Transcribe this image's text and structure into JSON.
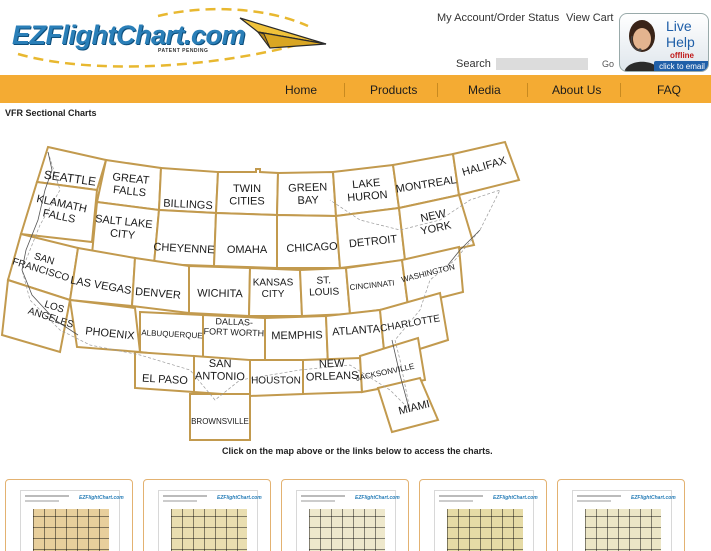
{
  "header": {
    "logo_text": "EZFlightChart.com",
    "logo_tagline": "PATENT PENDING",
    "account_link": "My Account/Order Status",
    "cart_link": "View Cart",
    "search_label": "Search",
    "search_value": "",
    "search_go": "Go",
    "live_help": {
      "line1": "Live",
      "line2": "Help",
      "status": "offline",
      "cta": "click to email"
    }
  },
  "nav": {
    "items": [
      "Home",
      "Products",
      "Media",
      "About Us",
      "FAQ"
    ]
  },
  "page_title": "VFR Sectional Charts",
  "map": {
    "regions": [
      [
        "SEATTLE"
      ],
      [
        "GREAT",
        "FALLS"
      ],
      [
        "BILLINGS"
      ],
      [
        "TWIN",
        "CITIES"
      ],
      [
        "GREEN",
        "BAY"
      ],
      [
        "LAKE",
        "HURON"
      ],
      [
        "MONTREAL"
      ],
      [
        "HALIFAX"
      ],
      [
        "KLAMATH",
        "FALLS"
      ],
      [
        "SALT LAKE",
        "CITY"
      ],
      [
        "CHEYENNE"
      ],
      [
        "OMAHA"
      ],
      [
        "CHICAGO"
      ],
      [
        "DETROIT"
      ],
      [
        "NEW",
        "YORK"
      ],
      [
        "SAN",
        "FRANCISCO"
      ],
      [
        "LAS VEGAS"
      ],
      [
        "DENVER"
      ],
      [
        "WICHITA"
      ],
      [
        "KANSAS",
        "CITY"
      ],
      [
        "ST.",
        "LOUIS"
      ],
      [
        "CINCINNATI"
      ],
      [
        "WASHINGTON"
      ],
      [
        "LOS",
        "ANGELES"
      ],
      [
        "PHOENIX"
      ],
      [
        "ALBUQUERQUE"
      ],
      [
        "DALLAS-",
        "FORT WORTH"
      ],
      [
        "MEMPHIS"
      ],
      [
        "ATLANTA"
      ],
      [
        "CHARLOTTE"
      ],
      [
        "EL PASO"
      ],
      [
        "SAN",
        "ANTONIO"
      ],
      [
        "HOUSTON"
      ],
      [
        "NEW",
        "ORLEANS"
      ],
      [
        "JACKSONVILLE"
      ],
      [
        "MIAMI"
      ],
      [
        "BROWNSVILLE"
      ]
    ]
  },
  "instructions": "Click on the map above or the links below to access the charts.",
  "cards": [
    {
      "brand": "EZFlightChart.com"
    },
    {
      "brand": "EZFlightChart.com"
    },
    {
      "brand": "EZFlightChart.com"
    },
    {
      "brand": "EZFlightChart.com"
    },
    {
      "brand": "EZFlightChart.com"
    }
  ]
}
